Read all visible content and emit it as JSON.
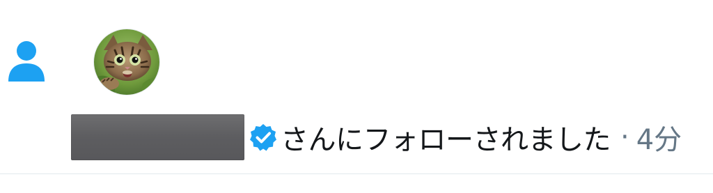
{
  "notification": {
    "icon": "person-icon",
    "avatar": "cat-avatar",
    "verified_icon": "verified-badge-icon",
    "text": "さんにフォローされました",
    "separator": "·",
    "time": "4分"
  },
  "colors": {
    "accent": "#1da1f2",
    "text": "#14171a",
    "muted": "#657786",
    "divider": "#e1e8ed"
  }
}
